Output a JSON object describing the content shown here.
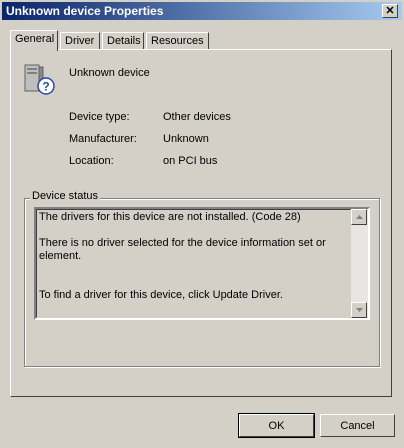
{
  "window": {
    "title": "Unknown device Properties"
  },
  "tabs": [
    {
      "label": "General",
      "active": true
    },
    {
      "label": "Driver",
      "active": false
    },
    {
      "label": "Details",
      "active": false
    },
    {
      "label": "Resources",
      "active": false
    }
  ],
  "device": {
    "icon": "unknown-device-icon",
    "name": "Unknown device",
    "properties": [
      {
        "label": "Device type:",
        "value": "Other devices"
      },
      {
        "label": "Manufacturer:",
        "value": "Unknown"
      },
      {
        "label": "Location:",
        "value": "on PCI bus"
      }
    ]
  },
  "status": {
    "group_label": "Device status",
    "lines": [
      "The drivers for this device are not installed. (Code 28)",
      "",
      "There is no driver selected for the device information set or element.",
      "",
      "",
      "To find a driver for this device, click Update Driver."
    ]
  },
  "buttons": {
    "ok": "OK",
    "cancel": "Cancel"
  }
}
